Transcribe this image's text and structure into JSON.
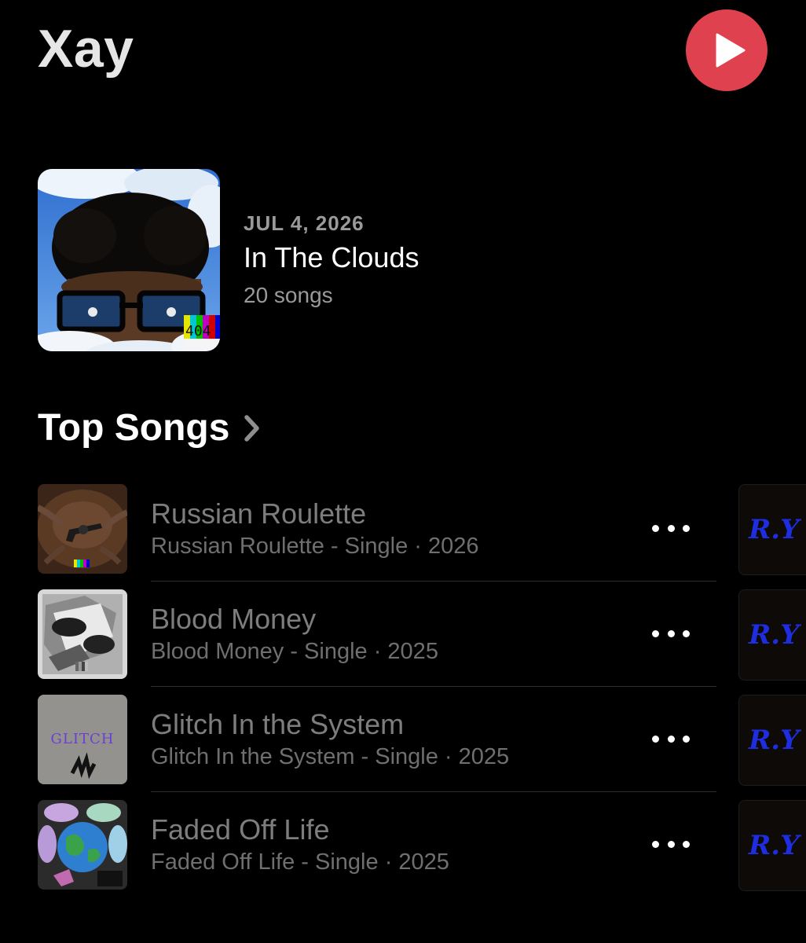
{
  "artist": {
    "name": "Xay"
  },
  "controls": {
    "play_icon": "play-icon",
    "accent_color": "#e0414f"
  },
  "latest_release": {
    "date": "JUL 4, 2026",
    "title": "In The Clouds",
    "song_count": "20 songs",
    "badge_text": "404"
  },
  "top_songs": {
    "heading": "Top Songs",
    "chevron_icon": "chevron-right-icon",
    "songs": [
      {
        "title": "Russian Roulette",
        "subtitle": "Russian Roulette - Single · 2026"
      },
      {
        "title": "Blood Money",
        "subtitle": "Blood Money - Single · 2025"
      },
      {
        "title": "Glitch In the System",
        "subtitle": "Glitch In the System - Single · 2025",
        "art_text": "GLITCH"
      },
      {
        "title": "Faded Off Life",
        "subtitle": "Faded Off Life - Single · 2025"
      }
    ],
    "more_icon": "ellipsis-icon",
    "next_column_art_text": "R.Y"
  }
}
